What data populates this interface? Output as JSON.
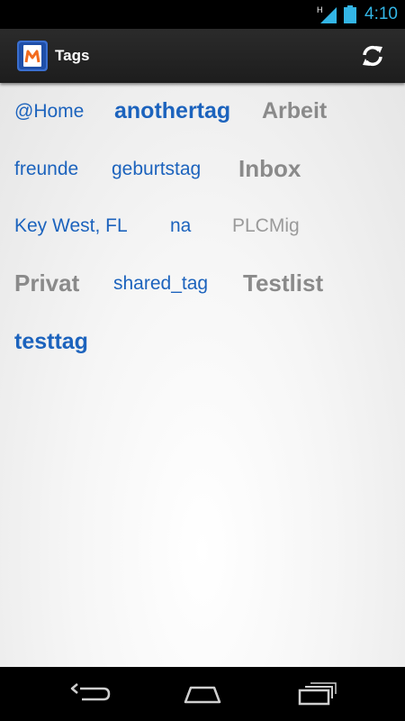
{
  "status_bar": {
    "time": "4:10",
    "network_type": "H",
    "signal_icon": "signal-icon",
    "battery_icon": "battery-icon"
  },
  "action_bar": {
    "title": "Tags",
    "app_icon": "app-logo-icon",
    "refresh_icon": "refresh-icon"
  },
  "tags": [
    {
      "label": "@Home"
    },
    {
      "label": "anothertag"
    },
    {
      "label": "Arbeit"
    },
    {
      "label": "freunde"
    },
    {
      "label": "geburtstag"
    },
    {
      "label": "Inbox"
    },
    {
      "label": "Key West, FL"
    },
    {
      "label": "na"
    },
    {
      "label": "PLCMig"
    },
    {
      "label": "Privat"
    },
    {
      "label": "shared_tag"
    },
    {
      "label": "Testlist"
    },
    {
      "label": "testtag"
    }
  ],
  "nav_bar": {
    "back_icon": "back-icon",
    "home_icon": "home-icon",
    "recents_icon": "recent-apps-icon"
  },
  "colors": {
    "tag_blue": "#1c63bd",
    "tag_gray": "#8a8a8a",
    "status_blue": "#33b5e5",
    "action_bar": "#222222"
  }
}
